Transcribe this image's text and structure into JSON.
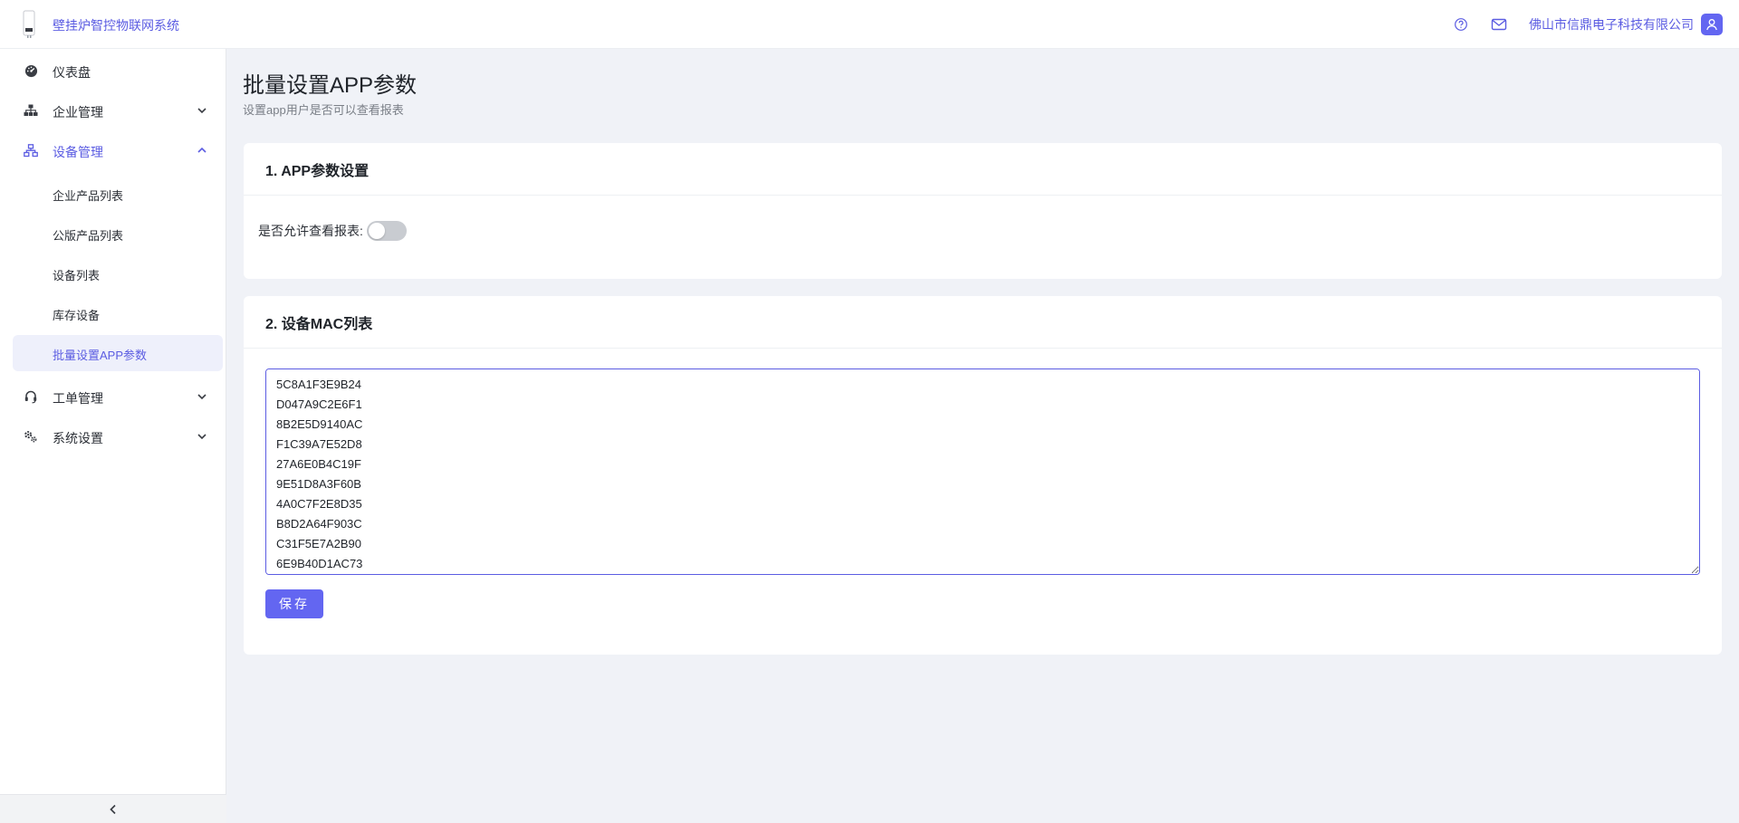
{
  "header": {
    "app_title": "壁挂炉智控物联网系统",
    "company": "佛山市信鼎电子科技有限公司",
    "accent_color": "#5b5ce2",
    "icons": [
      "help-circle-icon",
      "mail-icon",
      "user-icon"
    ]
  },
  "sidebar": {
    "items": [
      {
        "label": "仪表盘",
        "icon": "dashboard-icon"
      },
      {
        "label": "企业管理",
        "icon": "org-chart-icon"
      },
      {
        "label": "设备管理",
        "icon": "network-icon"
      },
      {
        "label": "工单管理",
        "icon": "headset-icon"
      },
      {
        "label": "系统设置",
        "icon": "gears-icon"
      }
    ],
    "device_sub": [
      {
        "label": "企业产品列表"
      },
      {
        "label": "公版产品列表"
      },
      {
        "label": "设备列表"
      },
      {
        "label": "库存设备"
      },
      {
        "label": "批量设置APP参数"
      }
    ],
    "selected": "批量设置APP参数"
  },
  "page": {
    "title": "批量设置APP参数",
    "subtitle": "设置app用户是否可以查看报表"
  },
  "section1": {
    "title": "1. APP参数设置",
    "switch_label": "是否允许查看报表:",
    "switch_on": false
  },
  "section2": {
    "title": "2. 设备MAC列表",
    "mac_text": "5C8A1F3E9B24\nD047A9C2E6F1\n8B2E5D9140AC\nF1C39A7E52D8\n27A6E0B4C19F\n9E51D8A3F60B\n4A0C7F2E8D35\nB8D2A64F903C\nC31F5E7A2B90\n6E9B40D1AC73",
    "save_label": "保存"
  }
}
